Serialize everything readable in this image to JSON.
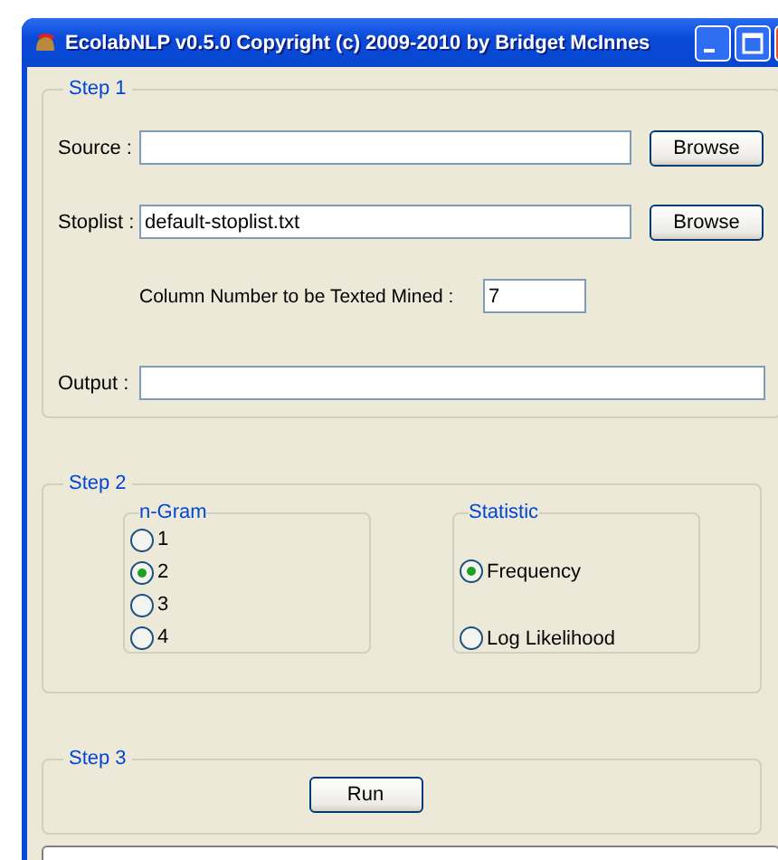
{
  "window": {
    "title": "EcolabNLP v0.5.0 Copyright (c) 2009-2010 by Bridget McInnes"
  },
  "step1": {
    "legend": "Step 1",
    "source": {
      "label": "Source :",
      "button": "Browse"
    },
    "stoplist": {
      "label": "Stoplist :",
      "value": "default-stoplist.txt",
      "button": "Browse"
    },
    "column": {
      "label": "Column Number to be Texted Mined :",
      "value": "7"
    },
    "output": {
      "label": "Output :"
    }
  },
  "step2": {
    "legend": "Step 2",
    "groups": [
      {
        "legend": "n-Gram",
        "options": [
          {
            "label": "1",
            "selected": false
          },
          {
            "label": "2",
            "selected": true
          },
          {
            "label": "3",
            "selected": false
          },
          {
            "label": "4",
            "selected": false
          }
        ]
      },
      {
        "legend": "Statistic",
        "options": [
          {
            "label": "Frequency",
            "selected": true
          },
          {
            "label": "Log Likelihood",
            "selected": false
          }
        ]
      }
    ]
  },
  "step3": {
    "legend": "Step 3",
    "button": "Run"
  }
}
